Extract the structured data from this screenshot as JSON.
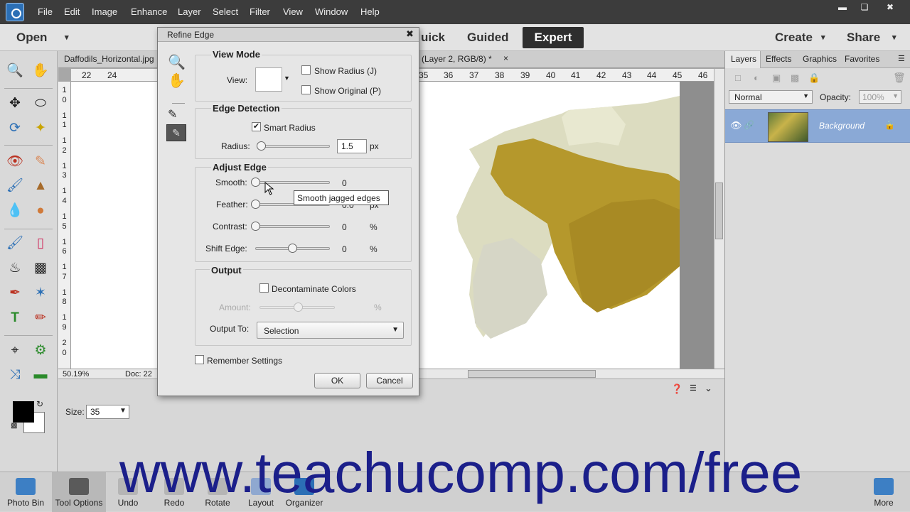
{
  "menu": {
    "items": [
      "File",
      "Edit",
      "Image",
      "Enhance",
      "Layer",
      "Select",
      "Filter",
      "View",
      "Window",
      "Help"
    ]
  },
  "modes": {
    "open": "Open",
    "quick": "uick",
    "guided": "Guided",
    "expert": "Expert",
    "create": "Create",
    "share": "Share"
  },
  "doc": {
    "tab1": "Daffodils_Horizontal.jpg",
    "tab2": "(Layer 2, RGB/8) *",
    "tab2_close": "×",
    "zoom": "50.19%",
    "doc_info": "Doc: 22",
    "ruler_h": [
      "22",
      "24",
      "35",
      "36",
      "37",
      "38",
      "39",
      "40",
      "41",
      "42",
      "43",
      "44",
      "45",
      "46"
    ],
    "ruler_v": [
      "1",
      "0",
      "1",
      "1",
      "1",
      "2",
      "1",
      "3",
      "1",
      "4",
      "1",
      "5",
      "1",
      "6",
      "1",
      "7",
      "1",
      "8",
      "1",
      "9",
      "2",
      "0"
    ]
  },
  "dialog": {
    "title": "Refine Edge",
    "close": "✖",
    "view_mode": {
      "title": "View Mode",
      "view_label": "View:",
      "show_radius": "Show Radius (J)",
      "show_original": "Show Original (P)"
    },
    "edge_detection": {
      "title": "Edge Detection",
      "smart_radius": "Smart Radius",
      "radius_label": "Radius:",
      "radius_value": "1.5",
      "radius_unit": "px"
    },
    "adjust_edge": {
      "title": "Adjust Edge",
      "smooth_label": "Smooth:",
      "smooth_value": "0",
      "feather_label": "Feather:",
      "feather_value": "0.0",
      "feather_unit": "px",
      "contrast_label": "Contrast:",
      "contrast_value": "0",
      "contrast_unit": "%",
      "shift_label": "Shift Edge:",
      "shift_value": "0",
      "shift_unit": "%"
    },
    "output": {
      "title": "Output",
      "decontaminate": "Decontaminate Colors",
      "amount_label": "Amount:",
      "amount_unit": "%",
      "output_to_label": "Output To:",
      "output_to_value": "Selection"
    },
    "remember": "Remember Settings",
    "ok": "OK",
    "cancel": "Cancel"
  },
  "tooltip": "Smooth jagged edges",
  "options": {
    "size_label": "Size:",
    "size_value": "35"
  },
  "panel": {
    "tabs": [
      "Layers",
      "Effects",
      "Graphics",
      "Favorites"
    ],
    "blend_mode": "Normal",
    "opacity_label": "Opacity:",
    "opacity_value": "100%",
    "layer_name": "Background"
  },
  "bottom": {
    "items": [
      "Photo Bin",
      "Tool Options",
      "Undo",
      "Redo",
      "Rotate",
      "Layout",
      "Organizer",
      "More"
    ]
  },
  "watermark": "www.teachucomp.com/free",
  "colors": {
    "accent": "#2b6fb5",
    "layer_selected": "#8aa9d6",
    "watermark": "#1b1f8a"
  }
}
